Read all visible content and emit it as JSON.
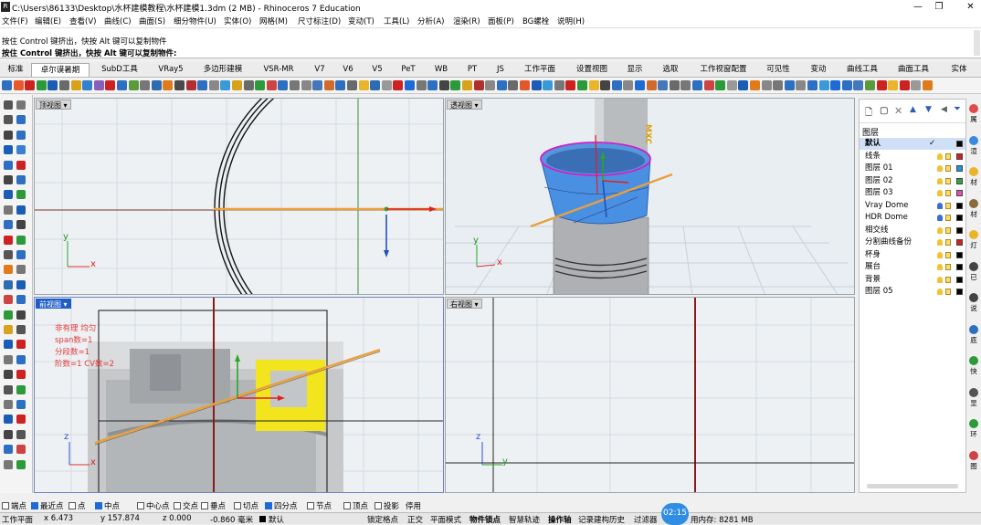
{
  "window": {
    "title": "C:\\Users\\86133\\Desktop\\水杯建模教程\\水杯建模1.3dm (2 MB) - Rhinoceros 7 Education",
    "logo": "rhino-logo",
    "controls": [
      "minimize-icon",
      "restore-icon",
      "close-icon"
    ]
  },
  "menu": [
    "文件(F)",
    "编辑(E)",
    "查看(V)",
    "曲线(C)",
    "曲面(S)",
    "细分物件(U)",
    "实体(O)",
    "网格(M)",
    "尺寸标注(D)",
    "变动(T)",
    "工具(L)",
    "分析(A)",
    "渲染(R)",
    "面板(P)",
    "BG螺栓",
    "说明(H)"
  ],
  "history": {
    "line1": "按住 Control 键挤出，快按 Alt 键可以复制物件",
    "command": "按住 Control 键挤出，快按 Alt 键可以复制物件:"
  },
  "tabs": [
    "标准",
    "卓尔谟暑期",
    "SubD工具",
    "VRay5",
    "多边形建模",
    "VSR-MR",
    "V7",
    "V6",
    "V5",
    "PeT",
    "WB",
    "PT",
    "JS",
    "工作平面",
    "设置视图",
    "显示",
    "选取",
    "工作视窗配置",
    "可见性",
    "变动",
    "曲线工具",
    "曲面工具",
    "实体"
  ],
  "active_tab": "卓尔谟暑期",
  "viewports": {
    "top": {
      "label": "顶视图"
    },
    "perspective": {
      "label": "透视图",
      "overlay_text": "MXC"
    },
    "front": {
      "label": "前视图",
      "annotation": {
        "title": "非有理 均匀",
        "spans": "span数=1",
        "segments": "分段数=1",
        "degree": "阶数=1   CV数=2"
      }
    },
    "right": {
      "label": "右视图"
    }
  },
  "axes": {
    "x": "x",
    "y": "y",
    "z": "z"
  },
  "layers": {
    "header": "图层",
    "items": [
      {
        "name": "默认",
        "current": true,
        "swatch": "#000000"
      },
      {
        "name": "线条",
        "swatch": "#d42020"
      },
      {
        "name": "图层 01",
        "swatch": "#2196d8"
      },
      {
        "name": "图层 02",
        "swatch": "#2eaa3a"
      },
      {
        "name": "图层 03",
        "swatch": "#e052b0"
      },
      {
        "name": "Vray Dome",
        "swatch": "#000000"
      },
      {
        "name": "HDR Dome",
        "swatch": "#000000"
      },
      {
        "name": "相交线",
        "swatch": "#000000"
      },
      {
        "name": "分割曲线备份",
        "swatch": "#d42020"
      },
      {
        "name": "杯身",
        "swatch": "#000000"
      },
      {
        "name": "展台",
        "swatch": "#000000"
      },
      {
        "name": "背景",
        "swatch": "#000000"
      },
      {
        "name": "图层 05",
        "swatch": "#000000"
      }
    ]
  },
  "side_tabs": [
    "属",
    "渲",
    "材",
    "材",
    "灯",
    "已",
    "说",
    "底",
    "快",
    "显",
    "环",
    "图"
  ],
  "snaps": [
    {
      "label": "端点",
      "on": false
    },
    {
      "label": "最近点",
      "on": true
    },
    {
      "label": "点",
      "on": false
    },
    {
      "label": "中点",
      "on": true
    },
    {
      "label": "中心点",
      "on": false
    },
    {
      "label": "交点",
      "on": false
    },
    {
      "label": "垂点",
      "on": false
    },
    {
      "label": "切点",
      "on": false
    },
    {
      "label": "四分点",
      "on": true
    },
    {
      "label": "节点",
      "on": false
    },
    {
      "label": "顶点",
      "on": false
    },
    {
      "label": "投影",
      "on": false
    },
    {
      "label": "停用",
      "on": false
    }
  ],
  "status": {
    "cplane": "工作平面",
    "x": "x 6.473",
    "y": "y 157.874",
    "z": "z 0.000",
    "dist": "-0.860 毫米",
    "layer": "默认",
    "modes": [
      "锁定格点",
      "正交",
      "平面模式",
      "物件锁点",
      "智慧轨迹",
      "操作轴",
      "记录建构历史",
      "过滤器"
    ],
    "bold_modes": [
      "物件锁点",
      "操作轴"
    ],
    "time": "02:15",
    "memory": "用内存: 8281 MB"
  }
}
